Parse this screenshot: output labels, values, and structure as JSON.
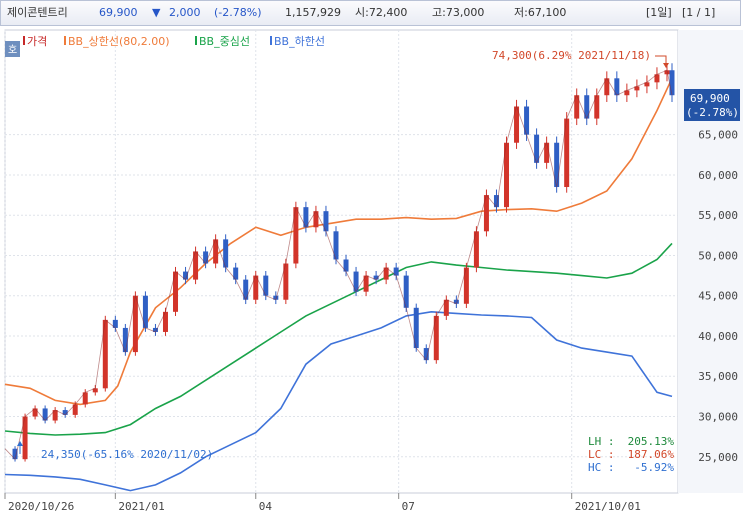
{
  "header": {
    "stock_name": "제이콘텐트리",
    "price": "69,900",
    "change_arrow": "▼",
    "change": "2,000",
    "change_pct": "(-2.78%)",
    "volume": "1,157,929",
    "open": "시:72,400",
    "high": "고:73,000",
    "low": "저:67,100",
    "period": "[1일]",
    "page": "[1 / 1]"
  },
  "chart_data": {
    "type": "line",
    "title": "",
    "legend": [
      {
        "name": "가격",
        "color": "#c62828"
      },
      {
        "name": "BB_상한선(80,2.00)",
        "color": "#ef7b3a"
      },
      {
        "name": "BB_중심선",
        "color": "#1aa34a"
      },
      {
        "name": "BB_하한선",
        "color": "#3f73d9"
      }
    ],
    "legend_placement": "top-left",
    "x_ticks": [
      "2020/10/26",
      "2021/01",
      "04",
      "07",
      "2021/10/01"
    ],
    "y_ticks": [
      25000,
      30000,
      35000,
      40000,
      45000,
      50000,
      55000,
      60000,
      65000
    ],
    "y_tick_labels": [
      "25,000",
      "30,000",
      "35,000",
      "40,000",
      "45,000",
      "50,000",
      "55,000",
      "60,000",
      "65,000"
    ],
    "ylim": [
      20500,
      78000
    ],
    "xlim": [
      0,
      266
    ],
    "grid": true,
    "price_series": {
      "name": "가격",
      "x": [
        0,
        4,
        8,
        12,
        16,
        20,
        24,
        28,
        32,
        36,
        40,
        44,
        48,
        52,
        56,
        60,
        64,
        68,
        72,
        76,
        80,
        84,
        88,
        92,
        96,
        100,
        104,
        108,
        112,
        116,
        120,
        124,
        128,
        132,
        136,
        140,
        144,
        148,
        152,
        156,
        160,
        164,
        168,
        172,
        176,
        180,
        184,
        188,
        192,
        196,
        200,
        204,
        208,
        212,
        216,
        220,
        224,
        228,
        232,
        236,
        240,
        244,
        248,
        252,
        256,
        260,
        264,
        266
      ],
      "y": [
        26000,
        24700,
        30000,
        31000,
        29500,
        30800,
        30200,
        31500,
        33000,
        33500,
        42000,
        41000,
        38000,
        45000,
        41000,
        40500,
        43000,
        48000,
        47000,
        50500,
        49000,
        52000,
        48500,
        47000,
        44500,
        47500,
        45000,
        44500,
        49000,
        56000,
        53500,
        55500,
        53000,
        49500,
        48000,
        45500,
        47500,
        47000,
        48500,
        47500,
        43500,
        38500,
        37000,
        42500,
        44500,
        44000,
        48500,
        53000,
        57500,
        56000,
        64000,
        68500,
        65000,
        61500,
        64000,
        58500,
        67000,
        69900,
        67000,
        69900,
        72000,
        69900,
        70500,
        71000,
        71500,
        72500,
        73000,
        69900
      ]
    },
    "bb_upper": {
      "name": "BB_상한선(80,2.00)",
      "x": [
        0,
        10,
        20,
        30,
        40,
        45,
        50,
        60,
        70,
        80,
        90,
        100,
        110,
        120,
        130,
        140,
        150,
        160,
        170,
        180,
        190,
        200,
        210,
        220,
        230,
        240,
        250,
        260,
        266
      ],
      "y": [
        34000,
        33500,
        32000,
        31500,
        32000,
        33800,
        38000,
        43500,
        46000,
        49000,
        51500,
        53500,
        52500,
        53500,
        54000,
        54500,
        54500,
        54700,
        54500,
        54600,
        55500,
        55700,
        55800,
        55500,
        56500,
        58000,
        62000,
        68000,
        72000
      ]
    },
    "bb_middle": {
      "name": "BB_중심선",
      "x": [
        0,
        10,
        20,
        30,
        40,
        50,
        60,
        70,
        80,
        90,
        100,
        110,
        120,
        130,
        140,
        150,
        160,
        170,
        180,
        190,
        200,
        210,
        220,
        230,
        240,
        250,
        260,
        266
      ],
      "y": [
        28200,
        27900,
        27700,
        27800,
        28000,
        29000,
        31000,
        32500,
        34500,
        36500,
        38500,
        40500,
        42500,
        44000,
        45500,
        47000,
        48500,
        49200,
        48800,
        48500,
        48200,
        48000,
        47800,
        47500,
        47200,
        47800,
        49500,
        51500
      ]
    },
    "bb_lower": {
      "name": "BB_하한선",
      "x": [
        0,
        10,
        20,
        30,
        40,
        50,
        60,
        70,
        80,
        90,
        100,
        110,
        120,
        130,
        140,
        150,
        160,
        170,
        180,
        190,
        200,
        210,
        220,
        230,
        240,
        250,
        260,
        266
      ],
      "y": [
        22800,
        22700,
        22500,
        22200,
        21500,
        20800,
        21500,
        23000,
        25000,
        26500,
        28000,
        31000,
        36500,
        39000,
        40000,
        41000,
        42500,
        43000,
        42800,
        42600,
        42500,
        42300,
        39500,
        38500,
        38000,
        37500,
        33000,
        32500
      ]
    },
    "annotations": {
      "high": "74,300(6.29% 2021/11/18)",
      "low": "24,350(-65.16% 2020/11/02)"
    },
    "last_price_label": "69,900",
    "last_change_label": "(-2.78%)",
    "stats": {
      "lh_label": "LH :",
      "lh_value": "205.13%",
      "lc_label": "LC :",
      "lc_value": "187.06%",
      "hc_label": "HC :",
      "hc_value": "-5.92%"
    },
    "corner_label": "호"
  }
}
